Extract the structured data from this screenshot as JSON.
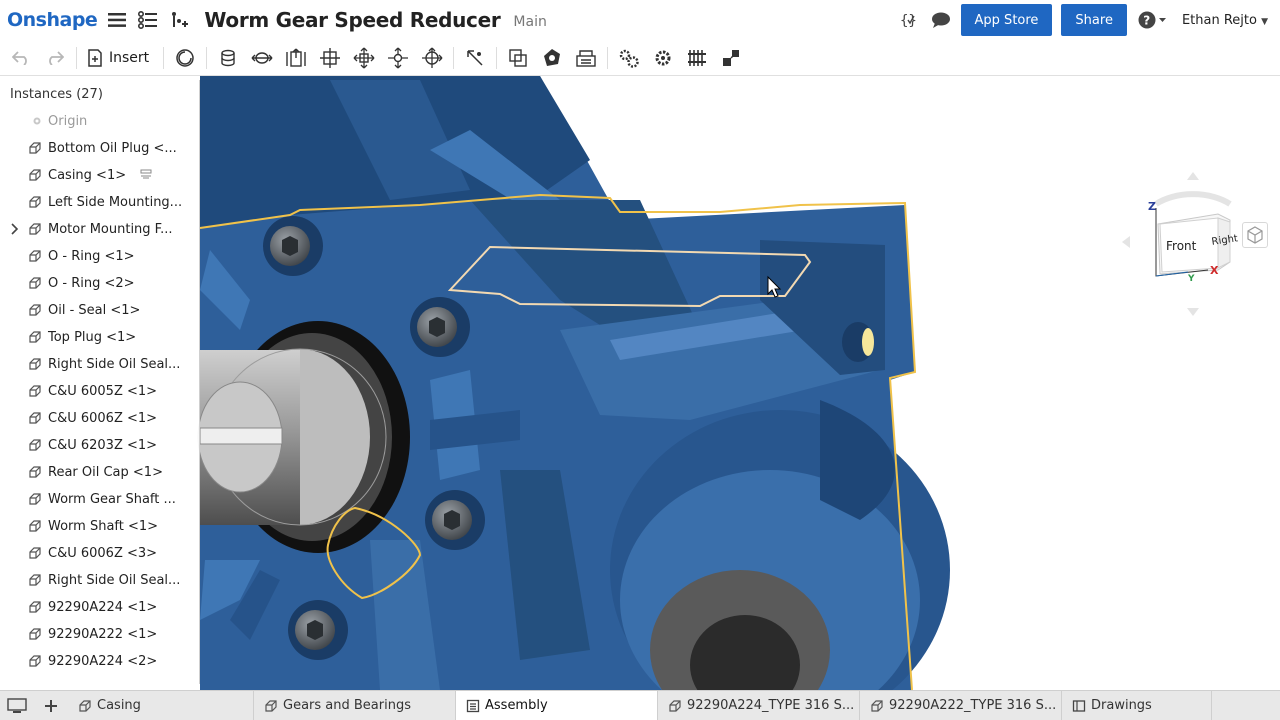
{
  "app": {
    "logo": "Onshape"
  },
  "document": {
    "title": "Worm Gear Speed Reducer",
    "workspace": "Main"
  },
  "header": {
    "app_store_label": "App Store",
    "share_label": "Share",
    "help_icon": "question-circle-icon",
    "user_name": "Ethan Rejto"
  },
  "toolbar": {
    "insert_label": "Insert",
    "icons": [
      "undo-icon",
      "redo-icon",
      "insert-icon",
      "revolute-mate-icon",
      "fastened-mate-icon",
      "slider-mate-icon",
      "planar-mate-icon",
      "cylindrical-mate-icon",
      "pin-slot-mate-icon",
      "ball-mate-icon",
      "mate-connector-icon",
      "group-icon",
      "replicate-icon",
      "linear-pattern-icon",
      "animate-icon",
      "gear-relation-icon",
      "rack-pinion-relation-icon",
      "screw-relation-icon",
      "exploded-view-icon"
    ]
  },
  "instances": {
    "header": "Instances (27)",
    "items": [
      {
        "label": "Origin",
        "dimmed": true,
        "icon": "origin-icon"
      },
      {
        "label": "Bottom Oil Plug <...",
        "icon": "part-icon"
      },
      {
        "label": "Casing <1>",
        "icon": "part-icon",
        "extra": "fixed-icon"
      },
      {
        "label": "Left Side Mounting...",
        "icon": "part-icon"
      },
      {
        "label": "Motor Mounting F...",
        "icon": "part-icon",
        "expandable": true
      },
      {
        "label": "O - Ring <1>",
        "icon": "part-icon"
      },
      {
        "label": "O - Ring <2>",
        "icon": "part-icon"
      },
      {
        "label": "Oil - Seal <1>",
        "icon": "part-icon"
      },
      {
        "label": "Top Plug <1>",
        "icon": "part-icon"
      },
      {
        "label": "Right Side Oil Seal...",
        "icon": "part-icon"
      },
      {
        "label": "C&U 6005Z <1>",
        "icon": "part-icon"
      },
      {
        "label": "C&U 6006Z <1>",
        "icon": "part-icon"
      },
      {
        "label": "C&U 6203Z <1>",
        "icon": "part-icon"
      },
      {
        "label": "Rear Oil Cap <1>",
        "icon": "part-icon"
      },
      {
        "label": "Worm Gear Shaft ...",
        "icon": "part-icon"
      },
      {
        "label": "Worm Shaft <1>",
        "icon": "part-icon"
      },
      {
        "label": "C&U 6006Z <3>",
        "icon": "part-icon"
      },
      {
        "label": "Right Side Oil Seal...",
        "icon": "part-icon"
      },
      {
        "label": "92290A224 <1>",
        "icon": "part-icon"
      },
      {
        "label": "92290A222 <1>",
        "icon": "part-icon"
      },
      {
        "label": "92290A224 <2>",
        "icon": "part-icon"
      }
    ]
  },
  "viewcube": {
    "front": "Front",
    "right": "Right",
    "axis_z": "Z",
    "axis_x": "X",
    "axis_y": "Y"
  },
  "tabs": [
    {
      "label": "Casing",
      "icon": "part-studio-icon",
      "active": false
    },
    {
      "label": "Gears and Bearings",
      "icon": "part-studio-icon",
      "active": false
    },
    {
      "label": "Assembly",
      "icon": "assembly-icon",
      "active": true
    },
    {
      "label": "92290A224_TYPE 316 S...",
      "icon": "part-studio-icon",
      "active": false
    },
    {
      "label": "92290A222_TYPE 316 S...",
      "icon": "part-studio-icon",
      "active": false
    },
    {
      "label": "Drawings",
      "icon": "drawing-icon",
      "active": false
    }
  ],
  "colors": {
    "brand": "#1f67c2",
    "model_blue": "#2e5f9a",
    "selection_outline": "#f0c24a"
  }
}
